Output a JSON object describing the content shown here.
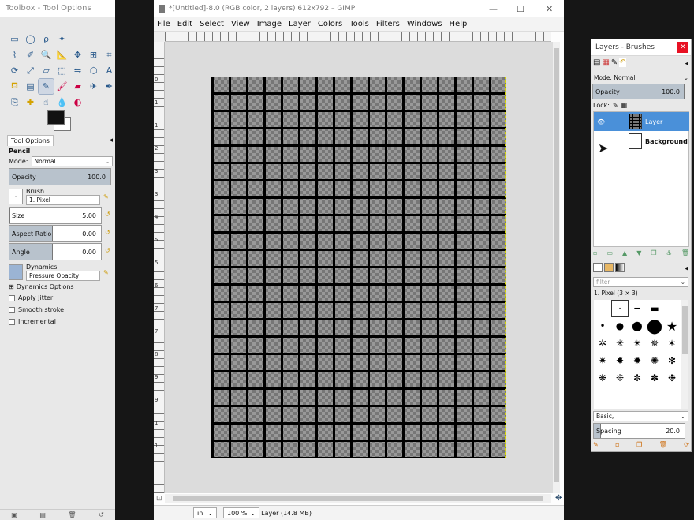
{
  "toolbox": {
    "title": "Toolbox - Tool Options",
    "tool_icons": [
      "rect-select-icon",
      "ellipse-select-icon",
      "free-select-icon",
      "fuzzy-select-icon",
      "",
      "",
      "",
      "paths-icon",
      "color-picker-icon",
      "zoom-icon",
      "measure-icon",
      "move-icon",
      "align-icon",
      "crop-icon",
      "rotate-icon",
      "scale-icon",
      "shear-icon",
      "perspective-icon",
      "flip-icon",
      "cage-icon",
      "text-icon",
      "bucket-fill-icon",
      "blend-icon",
      "pencil-icon",
      "paintbrush-icon",
      "eraser-icon",
      "airbrush-icon",
      "ink-icon",
      "clone-icon",
      "heal-icon",
      "smudge-icon",
      "blur-icon",
      "dodge-icon"
    ],
    "tab_label": "Tool Options",
    "tool_name": "Pencil",
    "mode_label": "Mode:",
    "mode_value": "Normal",
    "opacity_label": "Opacity",
    "opacity_value": "100.0",
    "brush_label": "Brush",
    "brush_value": "1. Pixel",
    "size_label": "Size",
    "size_value": "5.00",
    "aspect_label": "Aspect Ratio",
    "aspect_value": "0.00",
    "angle_label": "Angle",
    "angle_value": "0.00",
    "dynamics_label": "Dynamics",
    "dynamics_value": "Pressure Opacity",
    "dynamics_options": "Dynamics Options",
    "apply_jitter": "Apply Jitter",
    "smooth_stroke": "Smooth stroke",
    "incremental": "Incremental",
    "fg_color": "#111111",
    "bg_color": "#ffffff"
  },
  "image_window": {
    "title": "*[Untitled]-8.0 (RGB color, 2 layers) 612x792 – GIMP",
    "menus": [
      "File",
      "Edit",
      "Select",
      "View",
      "Image",
      "Layer",
      "Colors",
      "Tools",
      "Filters",
      "Windows",
      "Help"
    ],
    "ruler_labels": [
      "0",
      "1",
      "1",
      "2",
      "3",
      "3",
      "4",
      "5",
      "5",
      "6",
      "7",
      "7",
      "8",
      "9",
      "9",
      "1",
      "1"
    ],
    "unit": "in",
    "zoom": "100 %",
    "status": "Layer (14.8 MB)"
  },
  "layers": {
    "title": "Layers - Brushes",
    "mode_label": "Mode: Normal",
    "opacity_label": "Opacity",
    "opacity_value": "100.0",
    "lock_label": "Lock:",
    "items": [
      {
        "name": "Layer"
      },
      {
        "name": "Background"
      }
    ],
    "filter_placeholder": "filter",
    "brush_name": "1. Pixel (3 × 3)",
    "brush_tag": "Basic,",
    "spacing_label": "Spacing",
    "spacing_value": "20.0"
  }
}
